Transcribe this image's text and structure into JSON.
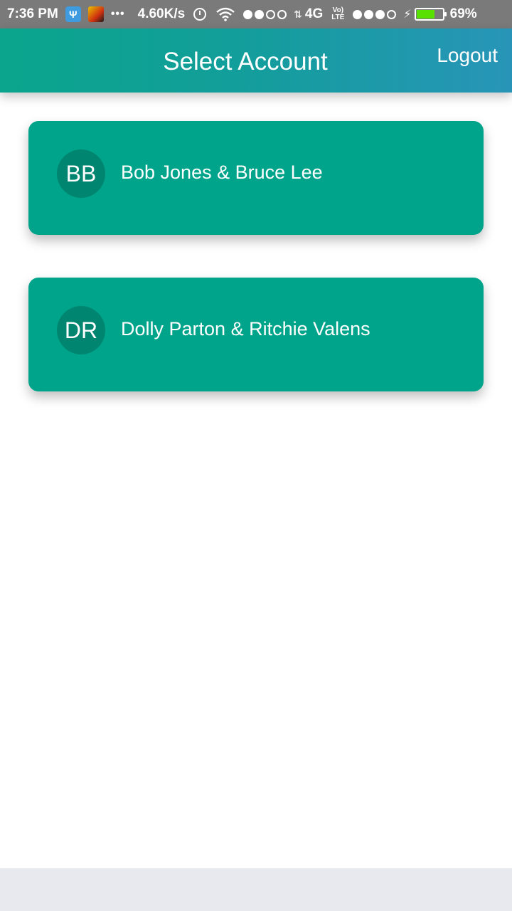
{
  "status_bar": {
    "time": "7:36 PM",
    "usb_icon": "usb-icon",
    "more": "•••",
    "net_speed": "4.60K/s",
    "network": "4G",
    "volte": "Vo)) LTE",
    "battery_percent": "69%",
    "battery_level": 0.69,
    "battery_color": "#58e000"
  },
  "app_bar": {
    "title": "Select Account",
    "logout_label": "Logout",
    "gradient_start": "#0aa58c",
    "gradient_end": "#2895b8"
  },
  "accounts": [
    {
      "initials": "BB",
      "name": "Bob Jones & Bruce Lee"
    },
    {
      "initials": "DR",
      "name": "Dolly Parton & Ritchie Valens"
    }
  ],
  "colors": {
    "card": "#00a48a",
    "avatar": "#008570"
  }
}
